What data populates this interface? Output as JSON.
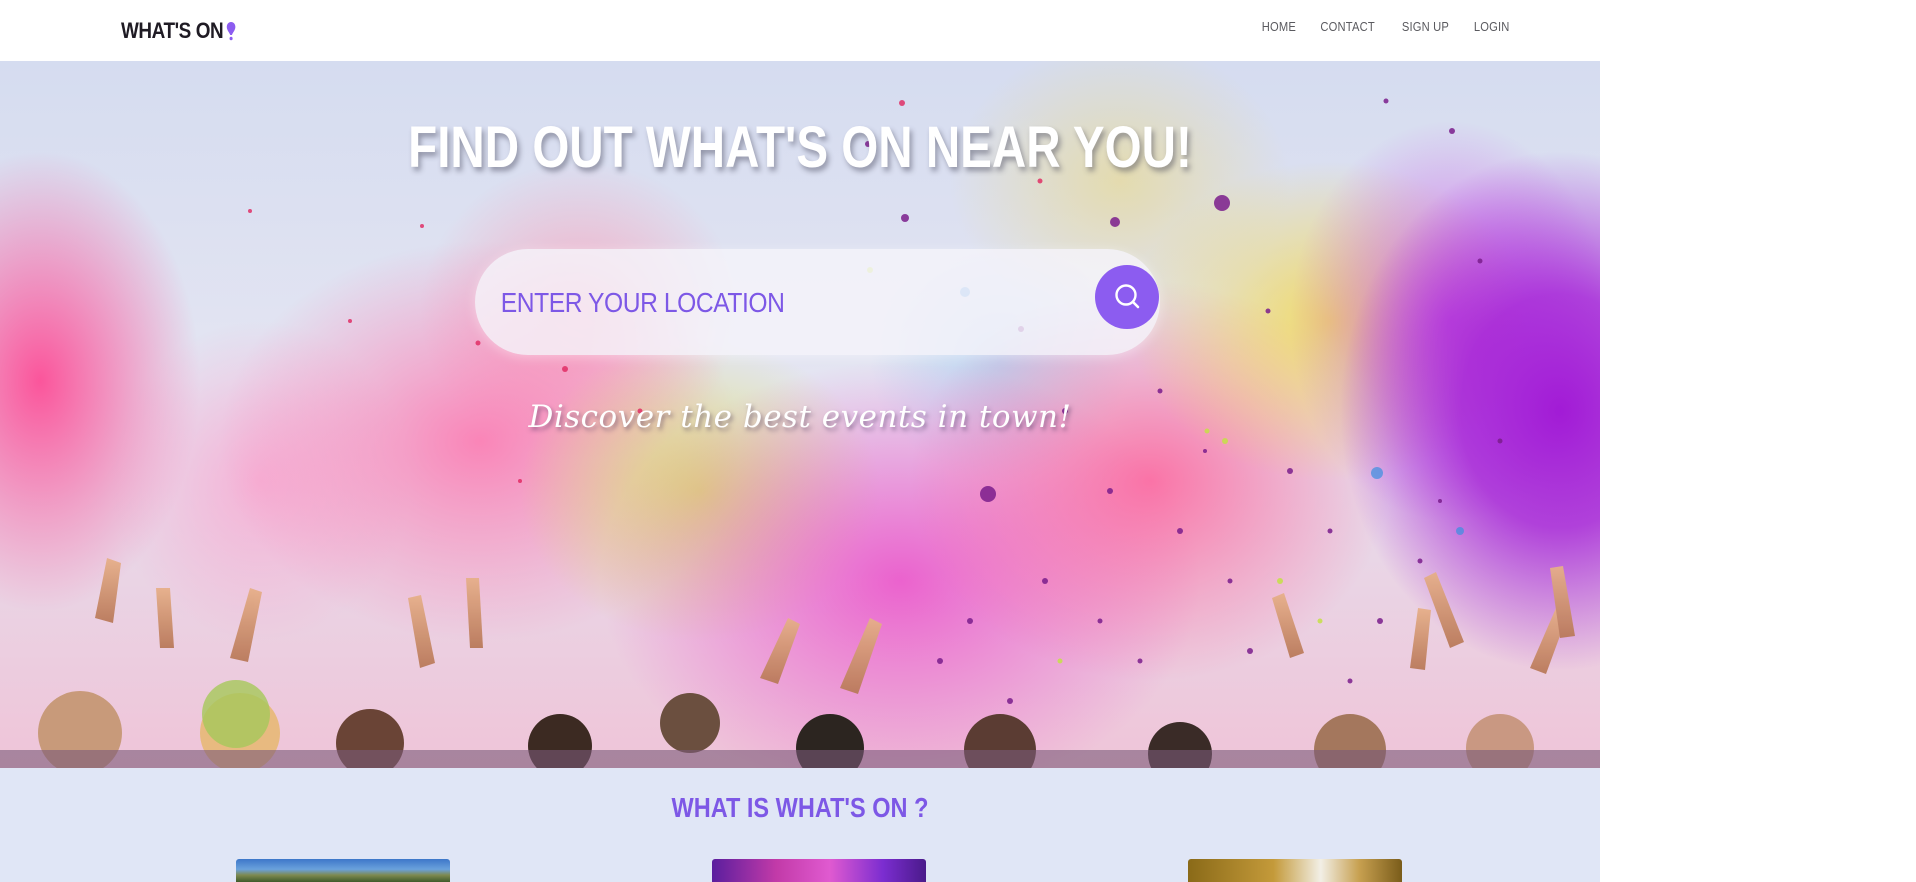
{
  "brand": {
    "logo_text": "WHAT'S ON",
    "logo_icon": "map-pin-icon",
    "accent": "#8c5cf0"
  },
  "nav": {
    "items": [
      {
        "label": "HOME"
      },
      {
        "label": "CONTACT"
      },
      {
        "label": "SIGN UP"
      },
      {
        "label": "LOGIN"
      }
    ]
  },
  "hero": {
    "headline": "FIND OUT WHAT'S ON NEAR YOU!",
    "search": {
      "placeholder": "ENTER YOUR LOCATION",
      "value": "",
      "button_icon": "search-icon"
    },
    "tagline": "Discover the best events in town!"
  },
  "about": {
    "title": "WHAT IS WHAT'S ON ?"
  },
  "colors": {
    "brand_purple": "#8c5cf0",
    "heading_purple": "#7d58e6",
    "section_bg": "#e0e6f6"
  }
}
